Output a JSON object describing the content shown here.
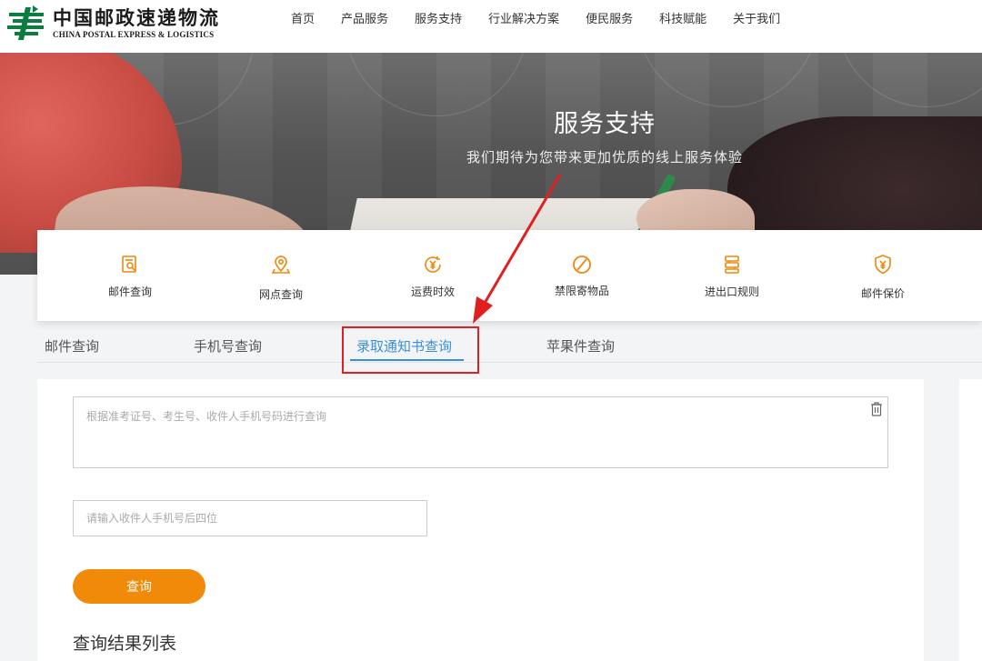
{
  "header": {
    "logo_cn": "中国邮政速递物流",
    "logo_en": "CHINA POSTAL EXPRESS & LOGISTICS",
    "nav": [
      "首页",
      "产品服务",
      "服务支持",
      "行业解决方案",
      "便民服务",
      "科技赋能",
      "关于我们"
    ]
  },
  "banner": {
    "title": "服务支持",
    "subtitle": "我们期待为您带来更加优质的线上服务体验"
  },
  "services": [
    {
      "label": "邮件查询",
      "icon": "mail-search-icon"
    },
    {
      "label": "网点查询",
      "icon": "location-pin-icon"
    },
    {
      "label": "运费时效",
      "icon": "yuan-clock-icon"
    },
    {
      "label": "禁限寄物品",
      "icon": "prohibited-icon"
    },
    {
      "label": "进出口规则",
      "icon": "customs-rules-icon"
    },
    {
      "label": "邮件保价",
      "icon": "yuan-shield-icon"
    }
  ],
  "tabs": [
    "邮件查询",
    "手机号查询",
    "录取通知书查询",
    "苹果件查询"
  ],
  "active_tab": "录取通知书查询",
  "form": {
    "main_placeholder": "根据准考证号、考生号、收件人手机号码进行查询",
    "phone_placeholder": "请输入收件人手机号后四位",
    "submit_label": "查询"
  },
  "results_title": "查询结果列表",
  "colors": {
    "accent_orange": "#f18a08",
    "icon_orange": "#f0870c",
    "tab_active": "#3b8fd9",
    "annotation_red": "#e02020",
    "logo_green": "#0b7d3e"
  }
}
